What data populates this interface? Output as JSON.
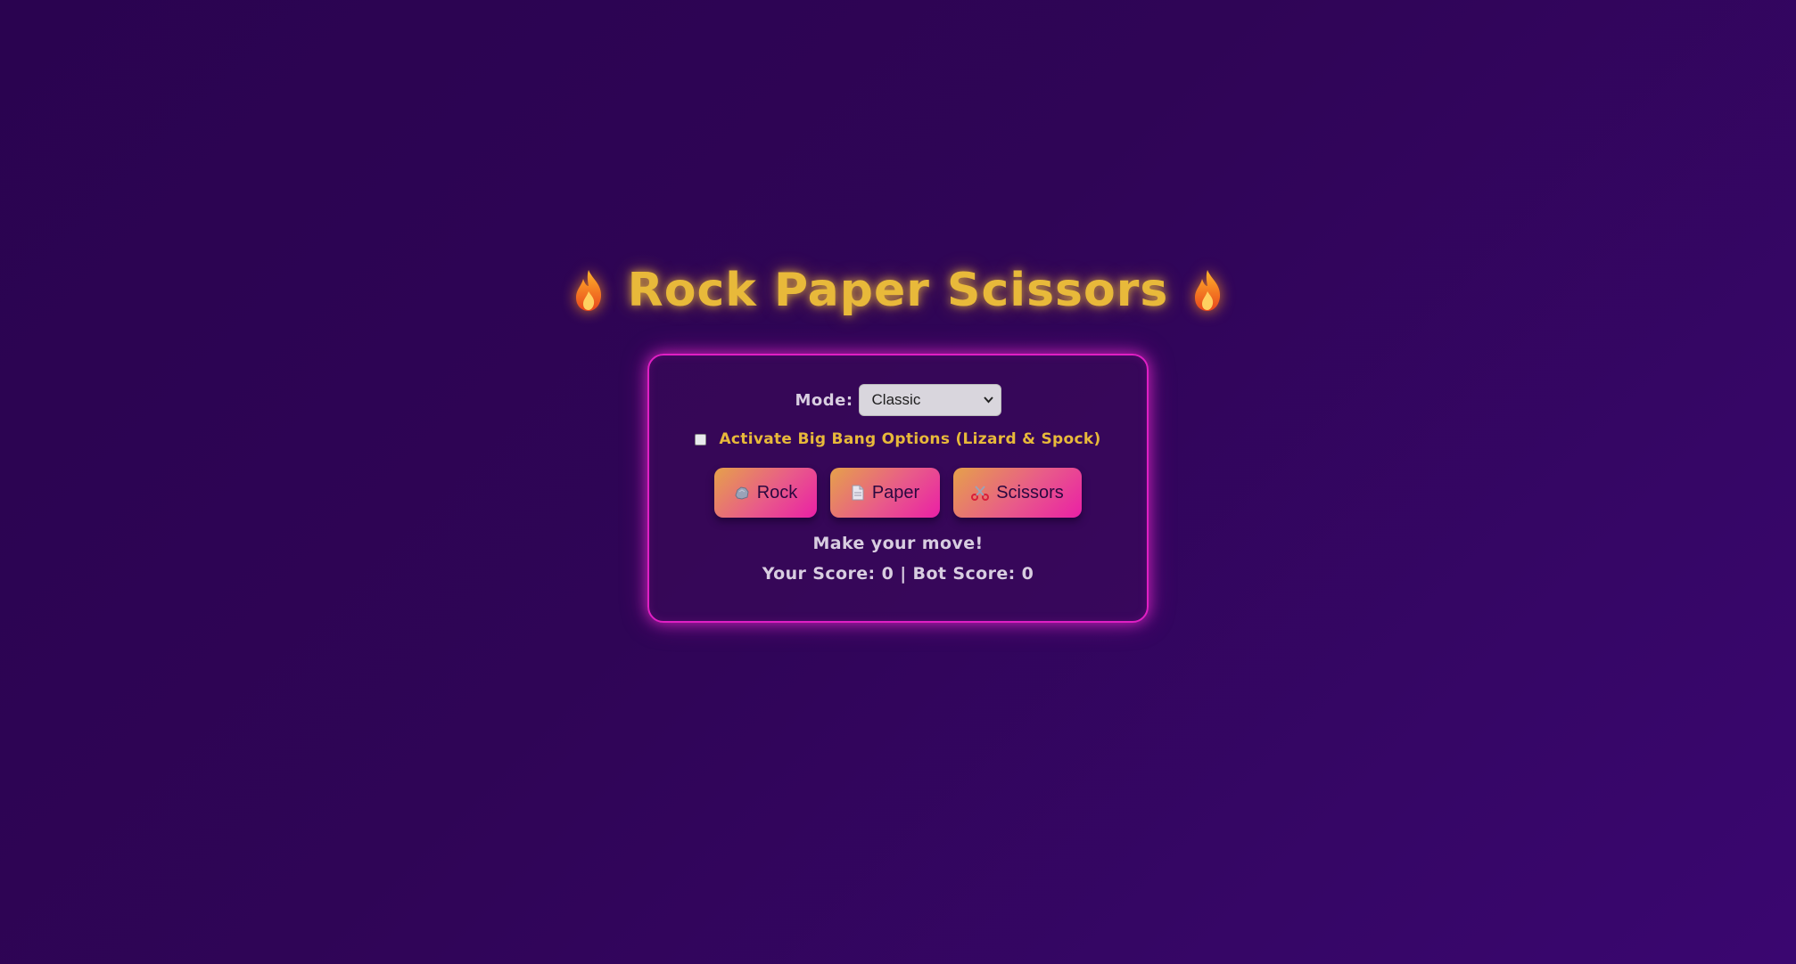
{
  "header": {
    "title": "Rock Paper Scissors",
    "left_icon": "fire-icon",
    "right_icon": "fire-icon"
  },
  "controls": {
    "mode_label": "Mode:",
    "mode_selected": "Classic",
    "bigbang_label": "Activate Big Bang Options (Lizard & Spock)",
    "bigbang_checked": false
  },
  "moves": [
    {
      "label": "Rock",
      "icon": "rock-icon"
    },
    {
      "label": "Paper",
      "icon": "paper-icon"
    },
    {
      "label": "Scissors",
      "icon": "scissors-icon"
    }
  ],
  "status": {
    "message": "Make your move!",
    "score_text": "Your Score: 0 | Bot Score: 0"
  },
  "colors": {
    "title_gold": "#e8b93a",
    "card_border": "#e01fc4",
    "background": "#2f0556"
  }
}
